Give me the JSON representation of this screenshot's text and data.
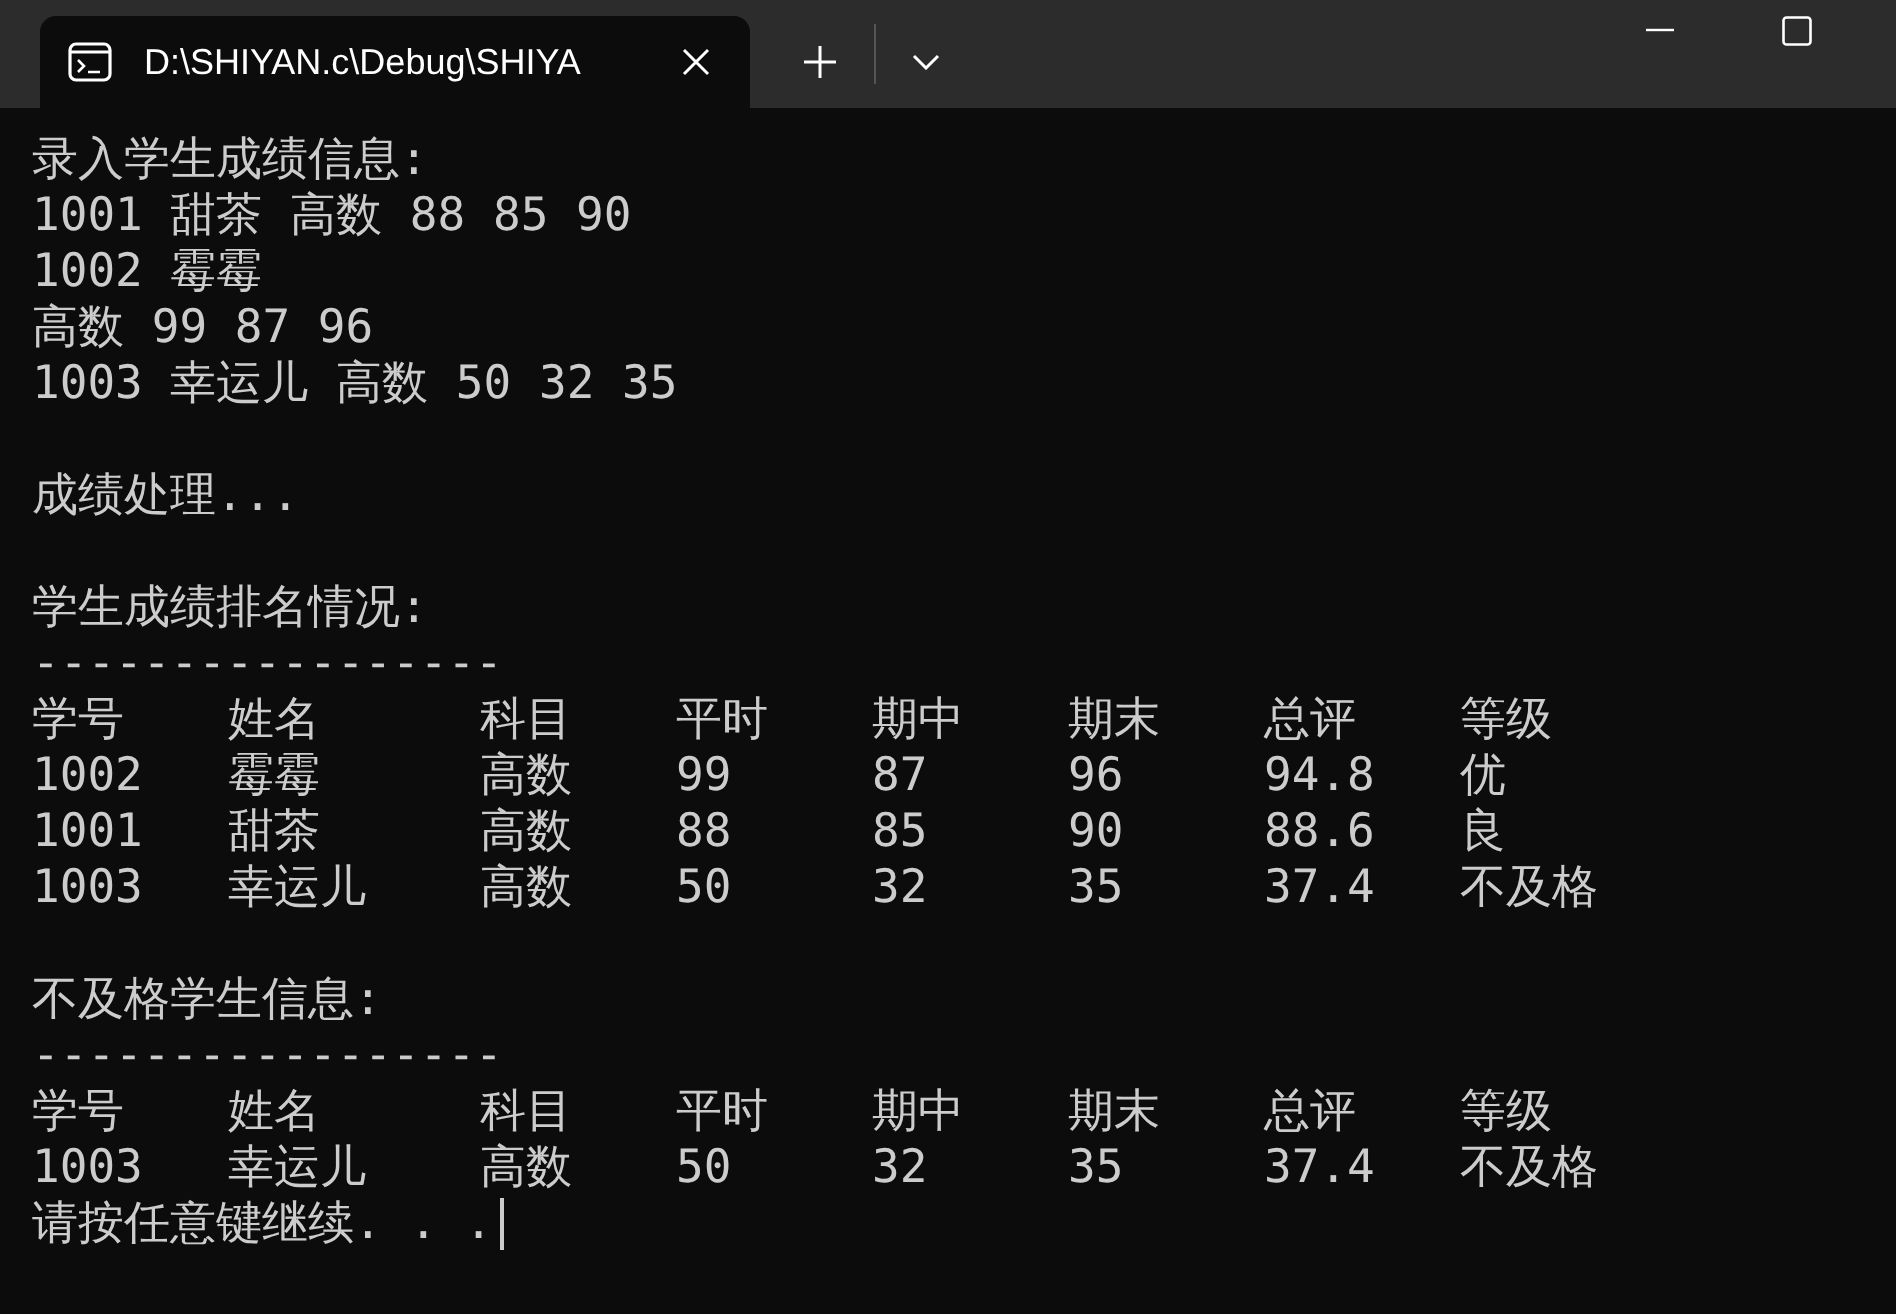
{
  "window": {
    "tab_title": "D:\\SHIYAN.c\\Debug\\SHIYA"
  },
  "lines": [
    {
      "kind": "text",
      "text": "录入学生成绩信息:"
    },
    {
      "kind": "text",
      "text": "1001 甜茶 高数 88 85 90"
    },
    {
      "kind": "text",
      "text": "1002 霉霉"
    },
    {
      "kind": "text",
      "text": "高数 99 87 96"
    },
    {
      "kind": "text",
      "text": "1003 幸运儿 高数 50 32 35"
    },
    {
      "kind": "blank"
    },
    {
      "kind": "text",
      "text": "成绩处理..."
    },
    {
      "kind": "blank"
    },
    {
      "kind": "text",
      "text": "学生成绩排名情况:"
    },
    {
      "kind": "text",
      "text": "-----------------"
    },
    {
      "kind": "row",
      "cells": [
        "学号",
        "姓名",
        "科目",
        "平时",
        "期中",
        "期末",
        "总评",
        "等级"
      ]
    },
    {
      "kind": "row",
      "cells": [
        "1002",
        "霉霉",
        "高数",
        "99",
        "87",
        "96",
        "94.8",
        "优"
      ]
    },
    {
      "kind": "row",
      "cells": [
        "1001",
        "甜茶",
        "高数",
        "88",
        "85",
        "90",
        "88.6",
        "良"
      ]
    },
    {
      "kind": "row",
      "cells": [
        "1003",
        "幸运儿",
        "高数",
        "50",
        "32",
        "35",
        "37.4",
        "不及格"
      ]
    },
    {
      "kind": "blank"
    },
    {
      "kind": "text",
      "text": "不及格学生信息:"
    },
    {
      "kind": "text",
      "text": "-----------------"
    },
    {
      "kind": "row",
      "cells": [
        "学号",
        "姓名",
        "科目",
        "平时",
        "期中",
        "期末",
        "总评",
        "等级"
      ]
    },
    {
      "kind": "row",
      "cells": [
        "1003",
        "幸运儿",
        "高数",
        "50",
        "32",
        "35",
        "37.4",
        "不及格"
      ]
    },
    {
      "kind": "prompt",
      "text": "请按任意键继续. . ."
    }
  ]
}
